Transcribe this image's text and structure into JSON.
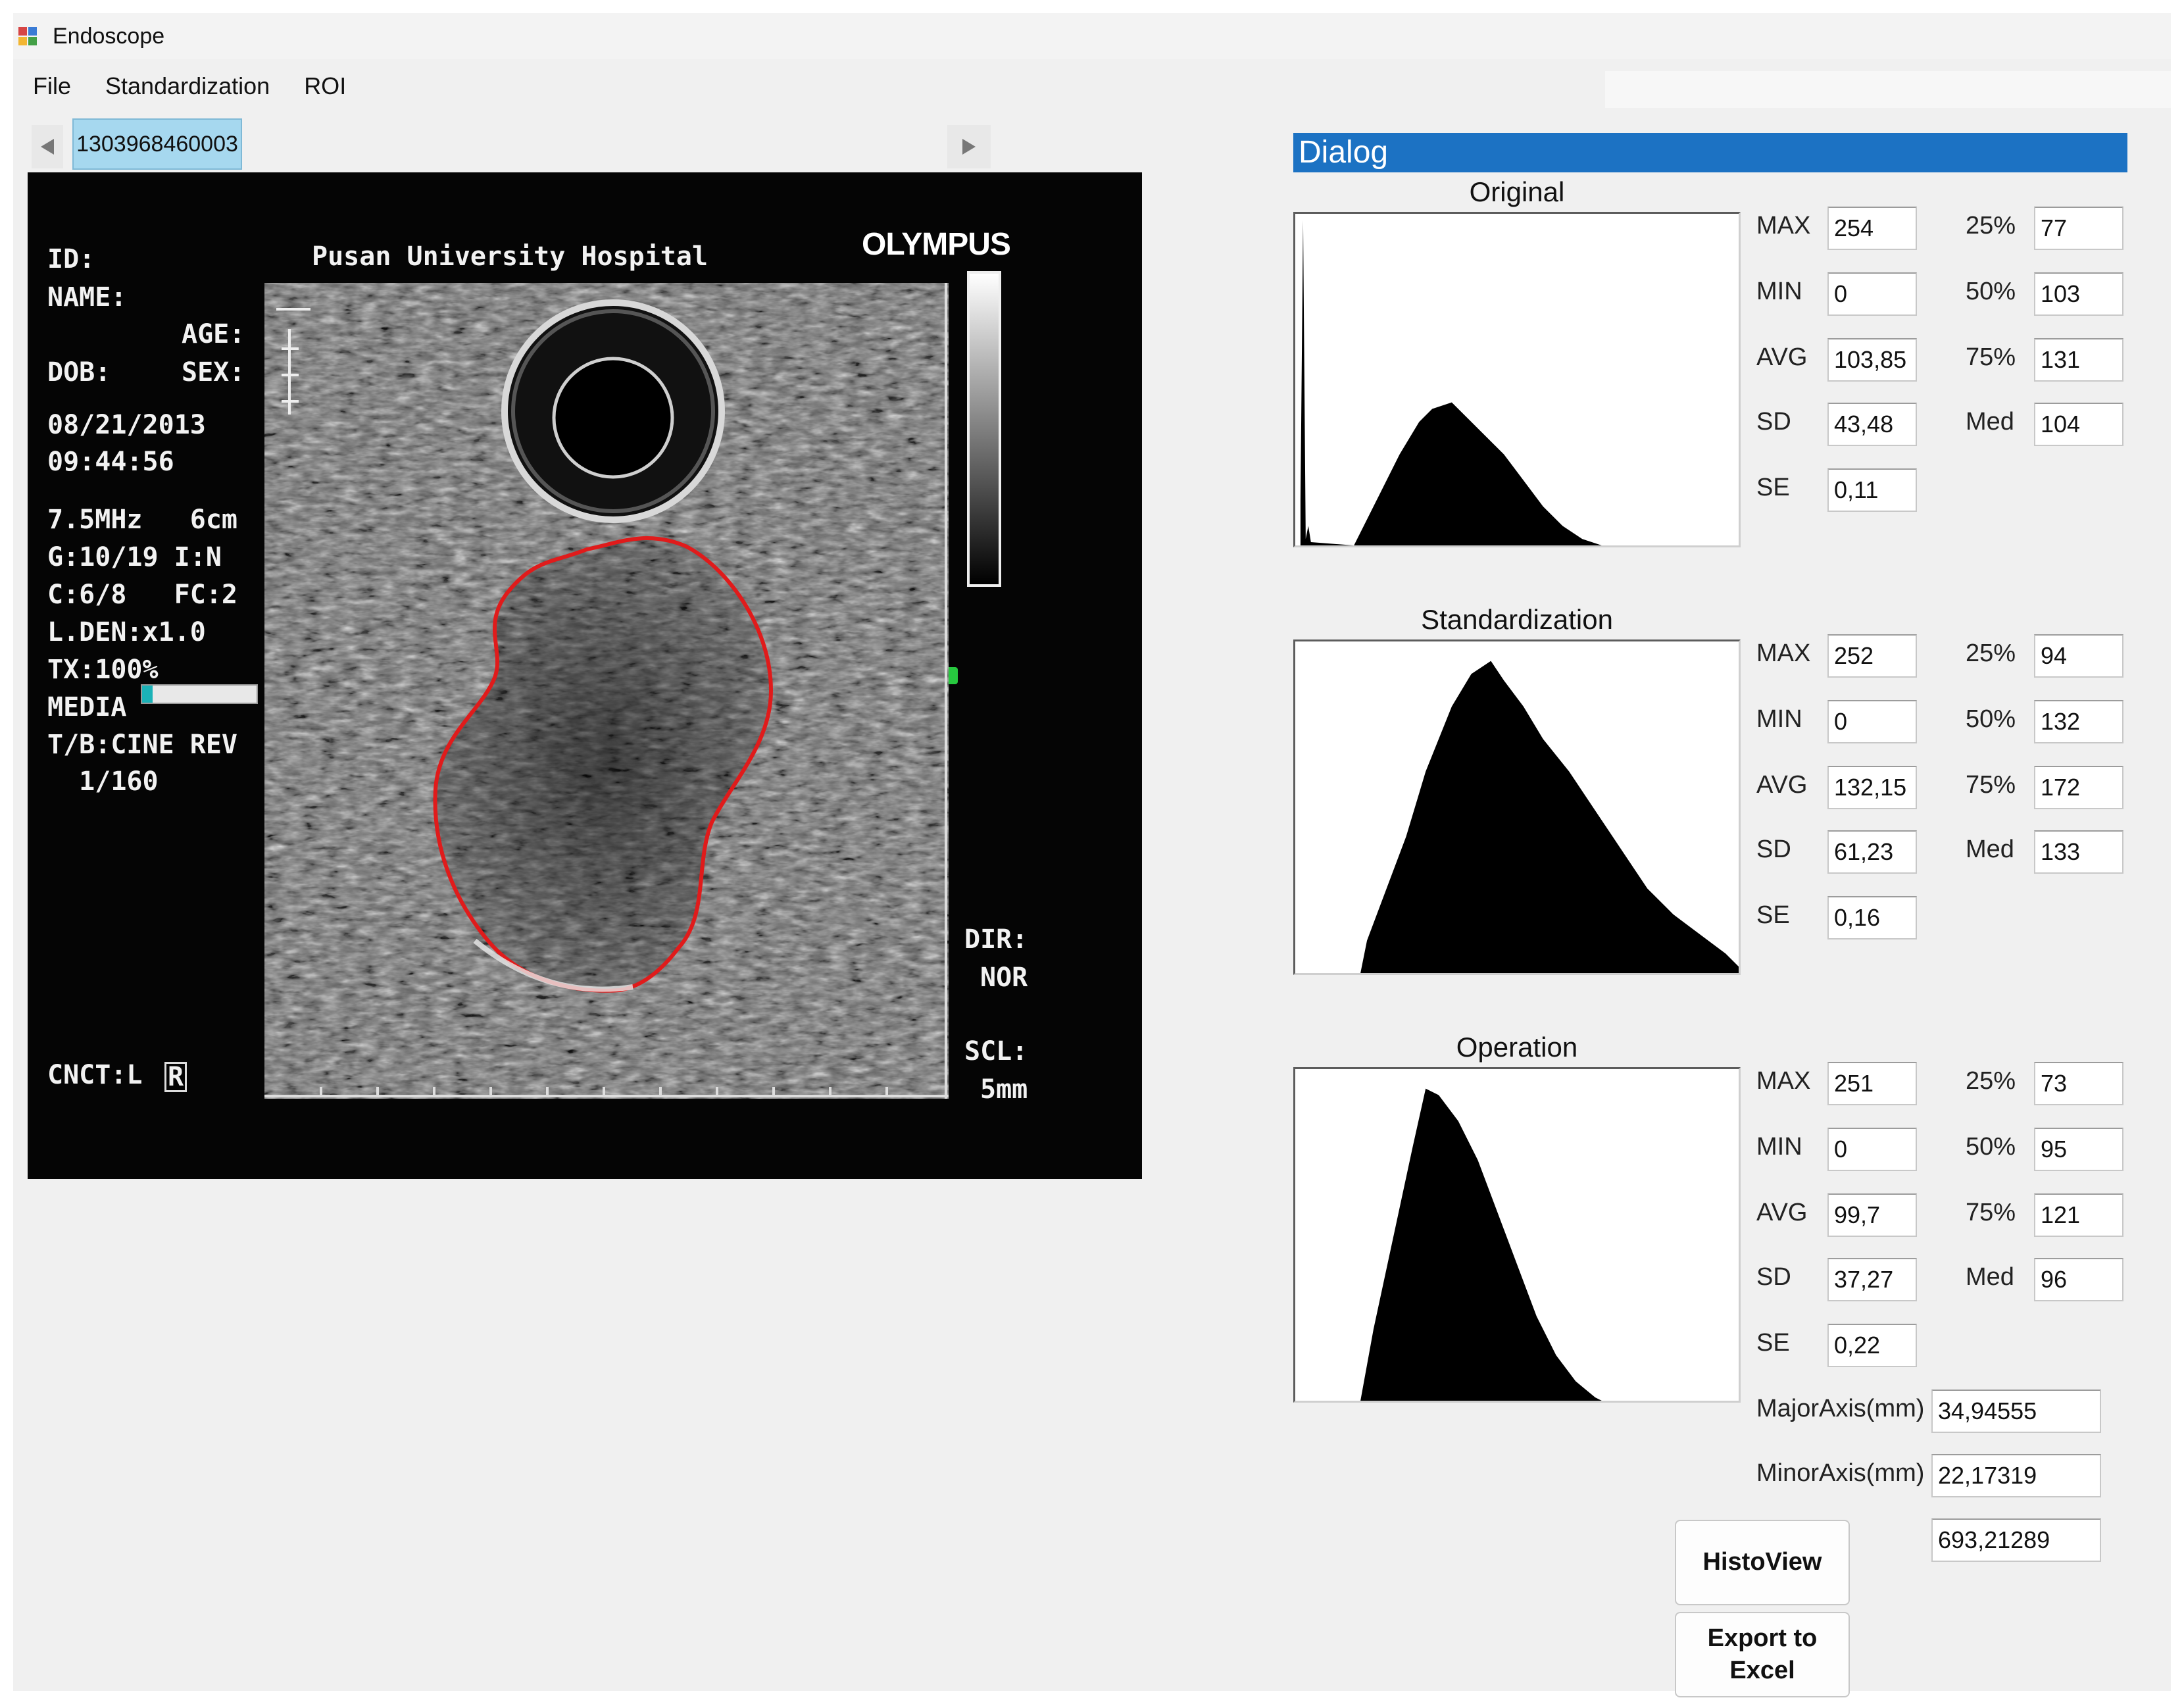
{
  "window": {
    "title": "Endoscope"
  },
  "menu": [
    {
      "label": "File"
    },
    {
      "label": "Standardization"
    },
    {
      "label": "ROI"
    }
  ],
  "tabs": {
    "active": "1303968460003"
  },
  "ultrasound": {
    "id_label": "ID:",
    "name_label": "NAME:",
    "age_label": "AGE:",
    "dob_label": "DOB:",
    "sex_label": "SEX:",
    "hospital": "Pusan University Hospital",
    "brand": "OLYMPUS",
    "date": "08/21/2013",
    "time": "09:44:56",
    "params": [
      "7.5MHz   6cm",
      "G:10/19 I:N",
      "C:6/8   FC:2",
      "L.DEN:x1.0",
      "TX:100%",
      "MEDIA",
      "T/B:CINE REV",
      "  1/160"
    ],
    "cnct": "CNCT:L",
    "cnct_r": "R",
    "dir_label": "DIR:",
    "dir_value": "NOR",
    "scl_label": "SCL:",
    "scl_value": "5mm",
    "media_level": 0.09,
    "roi_color": "#e01b1b"
  },
  "dialog": {
    "title": "Dialog",
    "stat_labels": {
      "max": "MAX",
      "min": "MIN",
      "avg": "AVG",
      "sd": "SD",
      "se": "SE",
      "p25": "25%",
      "p50": "50%",
      "p75": "75%",
      "med": "Med"
    },
    "sections": [
      {
        "title": "Original",
        "max": "254",
        "min": "0",
        "avg": "103,85",
        "sd": "43,48",
        "se": "0,11",
        "p25": "77",
        "p50": "103",
        "p75": "131",
        "med": "104"
      },
      {
        "title": "Standardization",
        "max": "252",
        "min": "0",
        "avg": "132,15",
        "sd": "61,23",
        "se": "0,16",
        "p25": "94",
        "p50": "132",
        "p75": "172",
        "med": "133"
      },
      {
        "title": "Operation",
        "max": "251",
        "min": "0",
        "avg": "99,7",
        "sd": "37,27",
        "se": "0,22",
        "p25": "73",
        "p50": "95",
        "p75": "121",
        "med": "96"
      }
    ],
    "major_axis_label": "MajorAxis(mm)",
    "major_axis": "34,94555",
    "minor_axis_label": "MinorAxis(mm)",
    "minor_axis": "22,17319",
    "area": "693,21289",
    "histoview_button": "HistoView",
    "export_button": "Export to Excel"
  }
}
